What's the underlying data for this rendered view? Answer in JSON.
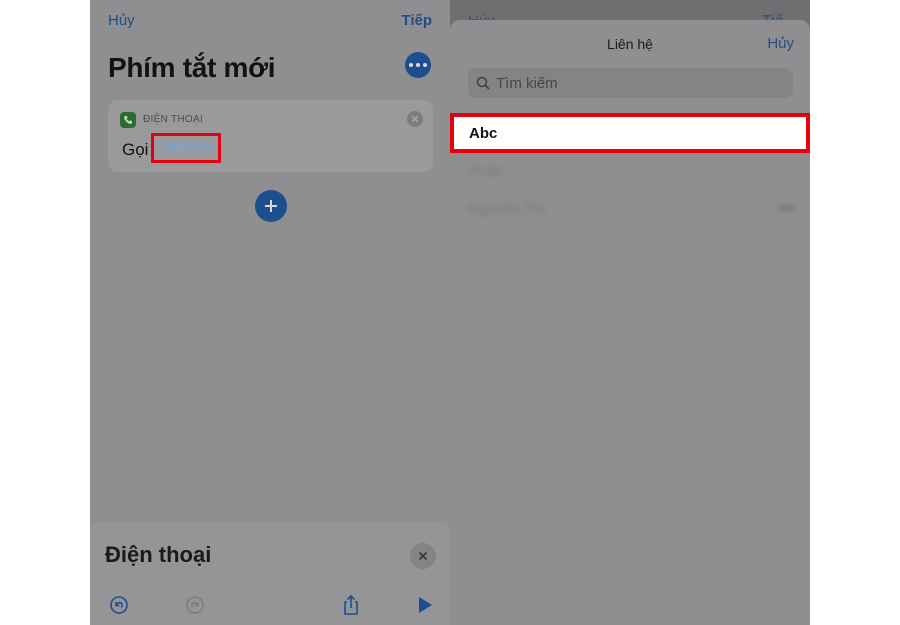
{
  "left": {
    "nav": {
      "cancel": "Hủy",
      "next": "Tiếp"
    },
    "title": "Phím tắt mới",
    "action_card": {
      "category": "ĐIỆN THOẠI",
      "verb": "Gọi",
      "token": "Liên hệ"
    },
    "bottom_sheet": {
      "title": "Điện thoại"
    }
  },
  "right": {
    "background_nav": {
      "cancel": "Hủy",
      "next": "Tiế"
    },
    "sheet": {
      "title": "Liên hệ",
      "action": "Hủy",
      "search_placeholder": "Tìm kiếm",
      "highlighted_contact": "Abc",
      "contacts": [
        "Xuân",
        "Nguyễn Thị"
      ]
    }
  },
  "colors": {
    "highlight_border": "#e3000f",
    "accent": "#1d4f8f",
    "token_text": "#6aa9e6"
  }
}
